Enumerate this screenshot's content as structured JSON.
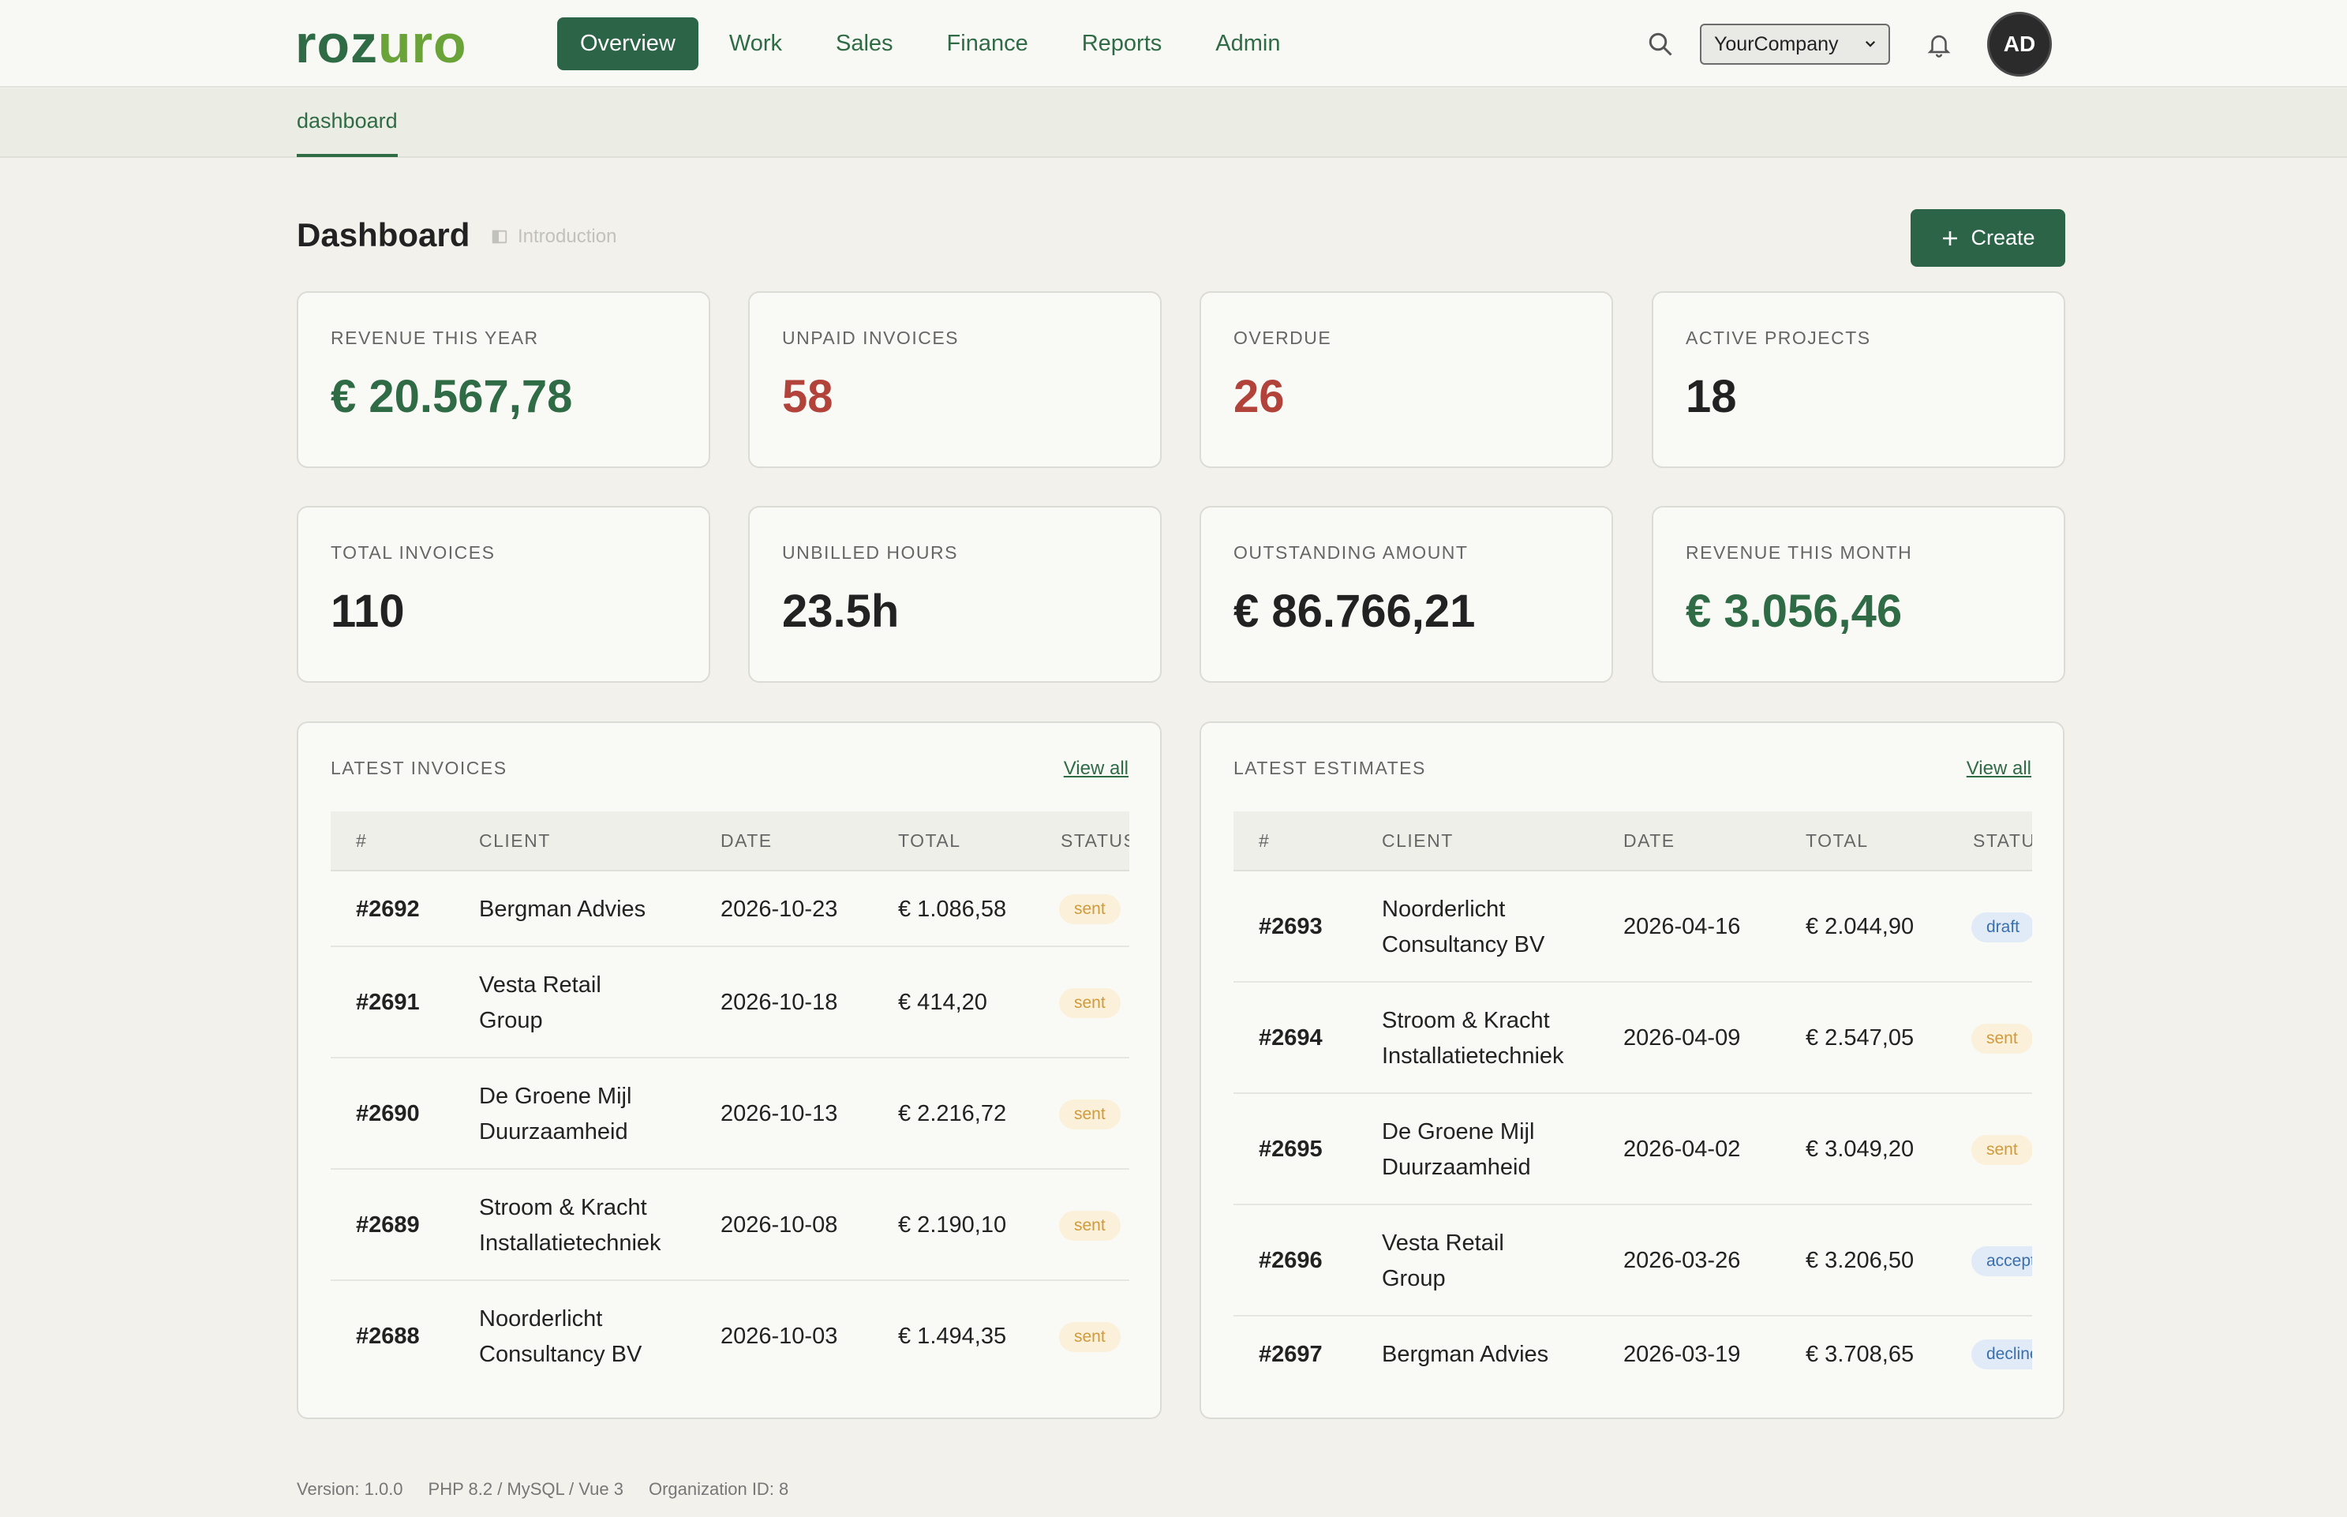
{
  "brand": {
    "logo_a": "roz",
    "logo_b": "uro"
  },
  "nav": {
    "items": [
      {
        "label": "Overview",
        "active": true
      },
      {
        "label": "Work"
      },
      {
        "label": "Sales"
      },
      {
        "label": "Finance"
      },
      {
        "label": "Reports"
      },
      {
        "label": "Admin"
      }
    ]
  },
  "header": {
    "company": "YourCompany",
    "avatar_initials": "AD"
  },
  "subnav": {
    "tab": "dashboard"
  },
  "page": {
    "title": "Dashboard",
    "intro_link": "Introduction",
    "create_label": "Create"
  },
  "stats": [
    {
      "label": "REVENUE THIS YEAR",
      "value": "€ 20.567,78",
      "tone": "green"
    },
    {
      "label": "UNPAID INVOICES",
      "value": "58",
      "tone": "red"
    },
    {
      "label": "OVERDUE",
      "value": "26",
      "tone": "red"
    },
    {
      "label": "ACTIVE PROJECTS",
      "value": "18",
      "tone": "default"
    },
    {
      "label": "TOTAL INVOICES",
      "value": "110",
      "tone": "default"
    },
    {
      "label": "UNBILLED HOURS",
      "value": "23.5h",
      "tone": "default"
    },
    {
      "label": "OUTSTANDING AMOUNT",
      "value": "€ 86.766,21",
      "tone": "default"
    },
    {
      "label": "REVENUE THIS MONTH",
      "value": "€ 3.056,46",
      "tone": "green"
    }
  ],
  "invoices": {
    "title": "LATEST INVOICES",
    "view_all": "View all",
    "columns": [
      "#",
      "CLIENT",
      "DATE",
      "TOTAL",
      "STATUS"
    ],
    "rows": [
      {
        "num": "#2692",
        "client": [
          "Bergman Advies"
        ],
        "date": "2026-10-23",
        "total": "€ 1.086,58",
        "status": "sent"
      },
      {
        "num": "#2691",
        "client": [
          "Vesta Retail",
          "Group"
        ],
        "date": "2026-10-18",
        "total": "€ 414,20",
        "status": "sent"
      },
      {
        "num": "#2690",
        "client": [
          "De Groene Mijl",
          "Duurzaamheid"
        ],
        "date": "2026-10-13",
        "total": "€ 2.216,72",
        "status": "sent"
      },
      {
        "num": "#2689",
        "client": [
          "Stroom & Kracht",
          "Installatietechniek"
        ],
        "date": "2026-10-08",
        "total": "€ 2.190,10",
        "status": "sent"
      },
      {
        "num": "#2688",
        "client": [
          "Noorderlicht",
          "Consultancy BV"
        ],
        "date": "2026-10-03",
        "total": "€ 1.494,35",
        "status": "sent"
      }
    ]
  },
  "estimates": {
    "title": "LATEST ESTIMATES",
    "view_all": "View all",
    "columns": [
      "#",
      "CLIENT",
      "DATE",
      "TOTAL",
      "STATUS"
    ],
    "rows": [
      {
        "num": "#2693",
        "client": [
          "Noorderlicht",
          "Consultancy BV"
        ],
        "date": "2026-04-16",
        "total": "€ 2.044,90",
        "status": "draft"
      },
      {
        "num": "#2694",
        "client": [
          "Stroom & Kracht",
          "Installatietechniek"
        ],
        "date": "2026-04-09",
        "total": "€ 2.547,05",
        "status": "sent"
      },
      {
        "num": "#2695",
        "client": [
          "De Groene Mijl",
          "Duurzaamheid"
        ],
        "date": "2026-04-02",
        "total": "€ 3.049,20",
        "status": "sent"
      },
      {
        "num": "#2696",
        "client": [
          "Vesta Retail",
          "Group"
        ],
        "date": "2026-03-26",
        "total": "€ 3.206,50",
        "status": "accepted"
      },
      {
        "num": "#2697",
        "client": [
          "Bergman Advies"
        ],
        "date": "2026-03-19",
        "total": "€ 3.708,65",
        "status": "declined"
      }
    ]
  },
  "footer": {
    "version": "Version: 1.0.0",
    "stack": "PHP 8.2 / MySQL / Vue 3",
    "org": "Organization ID: 8"
  },
  "colors": {
    "brand": "#2c6447",
    "brand_light": "#6aa338",
    "danger": "#b2433a"
  }
}
